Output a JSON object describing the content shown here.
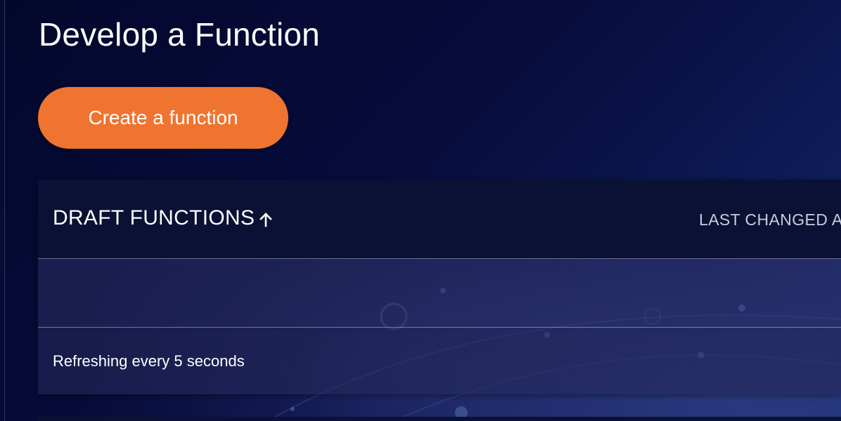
{
  "page": {
    "title": "Develop a Function"
  },
  "actions": {
    "create_label": "Create a function"
  },
  "draft_table": {
    "column_name": "DRAFT FUNCTIONS",
    "sort_icon": "arrow-up-icon",
    "column_last_changed": "LAST CHANGED A",
    "rows": [],
    "footer_text": "Refreshing every 5 seconds"
  },
  "colors": {
    "accent": "#ef7430",
    "background_dark": "#04072b",
    "table_header": "#0b1134"
  }
}
